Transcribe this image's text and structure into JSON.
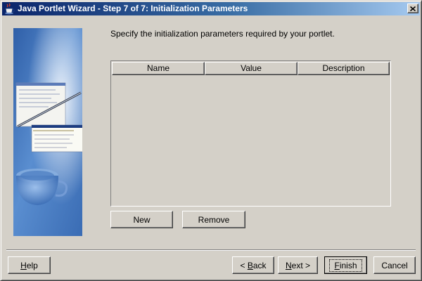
{
  "window": {
    "title": "Java Portlet Wizard - Step 7 of 7: Initialization Parameters"
  },
  "main": {
    "instruction": "Specify the initialization parameters required by your portlet."
  },
  "table": {
    "columns": [
      "Name",
      "Value",
      "Description"
    ],
    "rows": []
  },
  "buttons": {
    "new": "New",
    "remove": "Remove",
    "help": {
      "mnemonic": "H",
      "rest": "elp"
    },
    "back": {
      "prefix": "< ",
      "mnemonic": "B",
      "rest": "ack"
    },
    "next": {
      "mnemonic": "N",
      "rest": "ext >"
    },
    "finish": {
      "mnemonic": "F",
      "rest": "inish"
    },
    "cancel": "Cancel"
  },
  "icons": {
    "title": "coffee-cup-icon",
    "close": "close-icon"
  },
  "colors": {
    "titlebar_start": "#0a246a",
    "titlebar_end": "#a6caf0",
    "dialog_bg": "#d4d0c8",
    "side_panel": "#4a7ab8"
  }
}
